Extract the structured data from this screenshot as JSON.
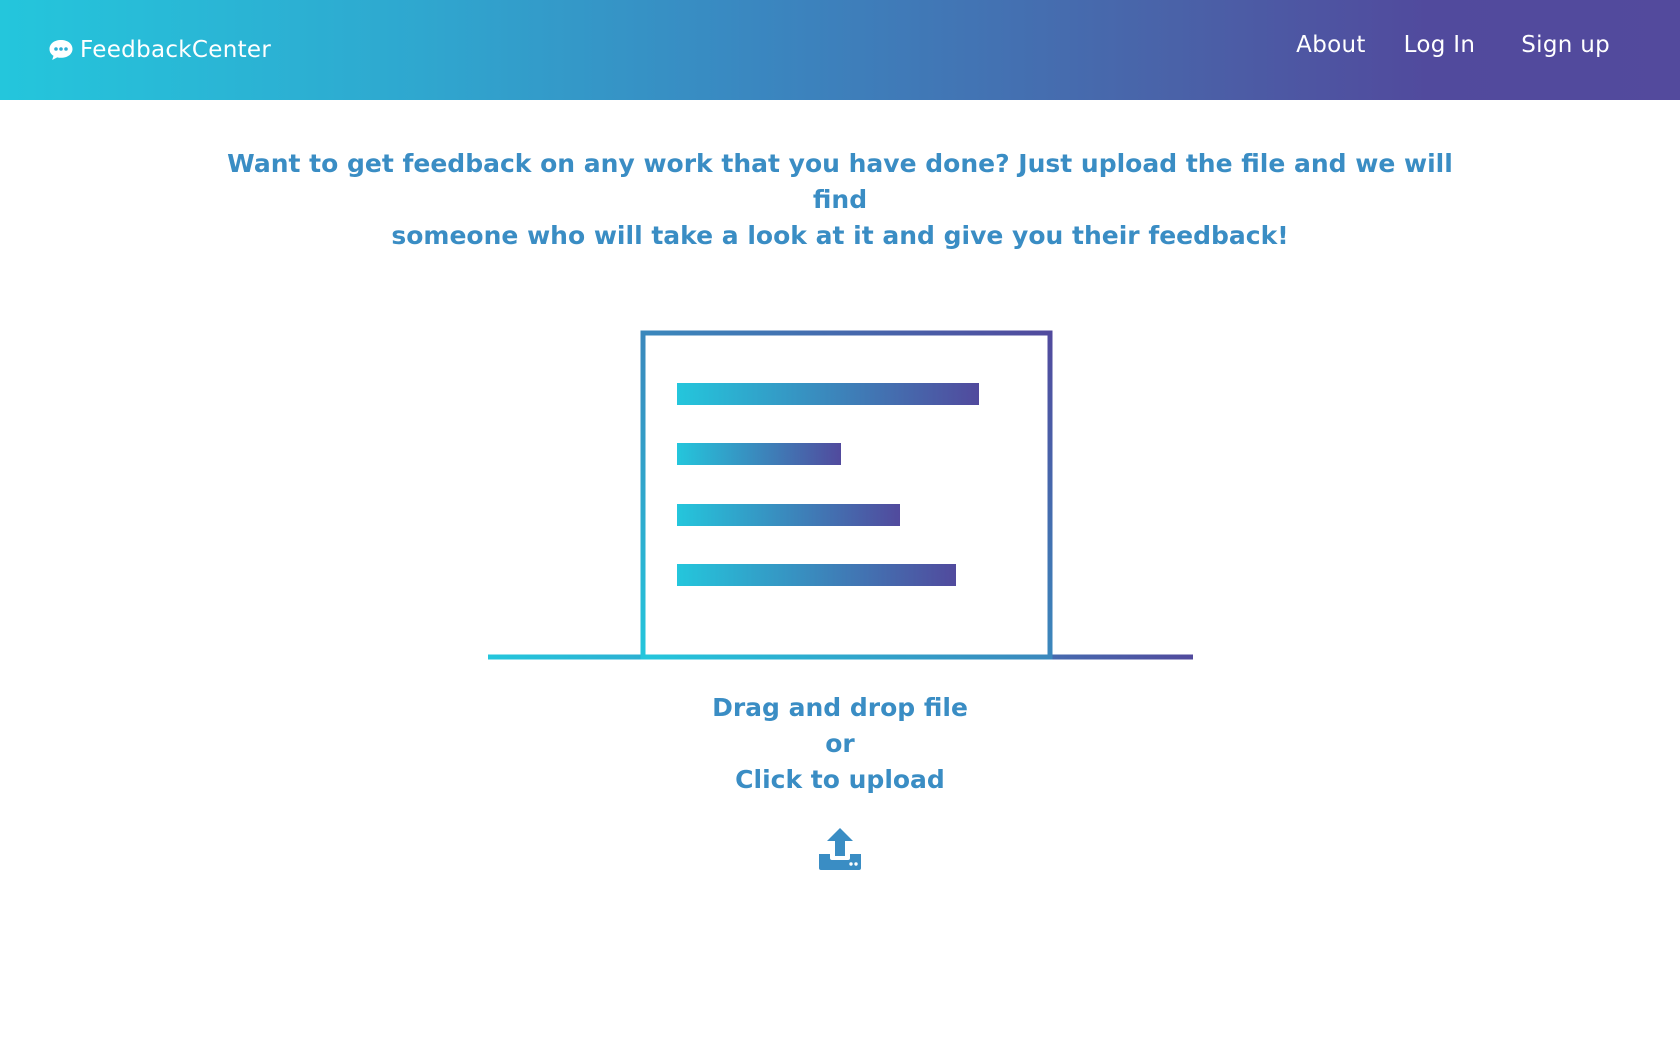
{
  "app": {
    "brand_name": "FeedbackCenter",
    "brand_icon": "chat-bubble-icon"
  },
  "nav": {
    "about": "About",
    "login": "Log In",
    "signup": "Sign up"
  },
  "intro": {
    "line1": "Want to get feedback on any work that you have done? Just upload the file and we will find",
    "line2": "someone who will take a look at it and give you their feedback!"
  },
  "upload": {
    "line1": "Drag and drop file",
    "line2": "or",
    "line3": "Click to upload",
    "icon": "upload-icon"
  },
  "colors": {
    "gradient_start": "#24c6dc",
    "gradient_end": "#514a9d",
    "text_accent": "#3a8dc4",
    "background": "#ffffff"
  }
}
